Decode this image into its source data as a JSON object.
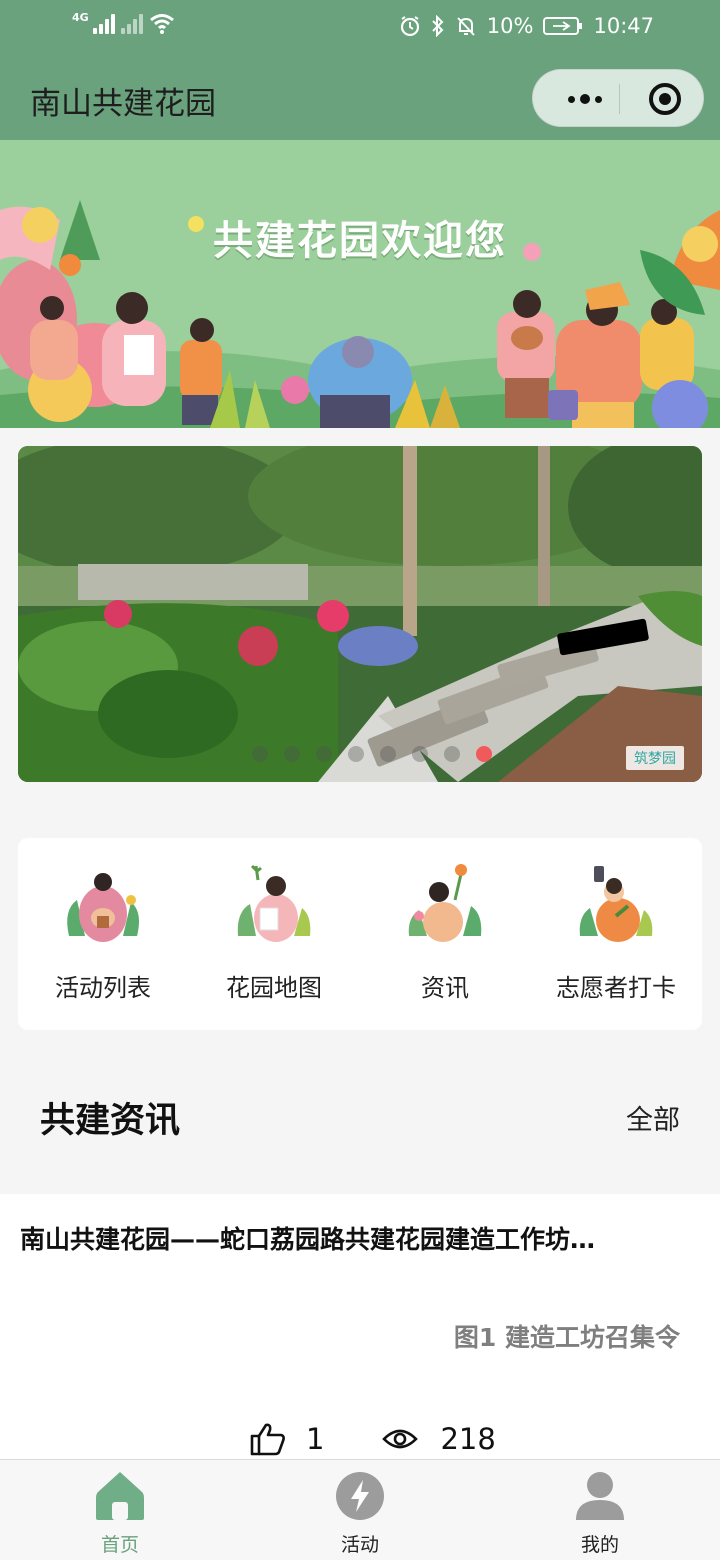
{
  "status_bar": {
    "network": "4G",
    "battery": "10%",
    "time": "10:47"
  },
  "nav": {
    "title": "南山共建花园"
  },
  "banner": {
    "title": "共建花园欢迎您"
  },
  "carousel": {
    "watermark": "筑梦园",
    "dot_count": 8,
    "active_index": 7
  },
  "quick_links": [
    {
      "label": "活动列表",
      "icon": "volunteer-with-pot-icon"
    },
    {
      "label": "花园地图",
      "icon": "volunteer-with-map-icon"
    },
    {
      "label": "资讯",
      "icon": "volunteer-with-flower-icon"
    },
    {
      "label": "志愿者打卡",
      "icon": "volunteer-with-phone-icon"
    }
  ],
  "news_section": {
    "title": "共建资讯",
    "more_label": "全部"
  },
  "news_item": {
    "title": "南山共建花园——蛇口荔园路共建花园建造工作坊…",
    "caption": "图1 建造工坊召集令",
    "likes": "1",
    "views": "218"
  },
  "tab_bar": {
    "tabs": [
      {
        "label": "首页",
        "icon": "home-icon",
        "active": true
      },
      {
        "label": "活动",
        "icon": "lightning-icon",
        "active": false
      },
      {
        "label": "我的",
        "icon": "user-icon",
        "active": false
      }
    ]
  },
  "colors": {
    "brand_green": "#6aa27e",
    "banner_green": "#9bcf9b",
    "active_dot": "#f05a5a"
  }
}
